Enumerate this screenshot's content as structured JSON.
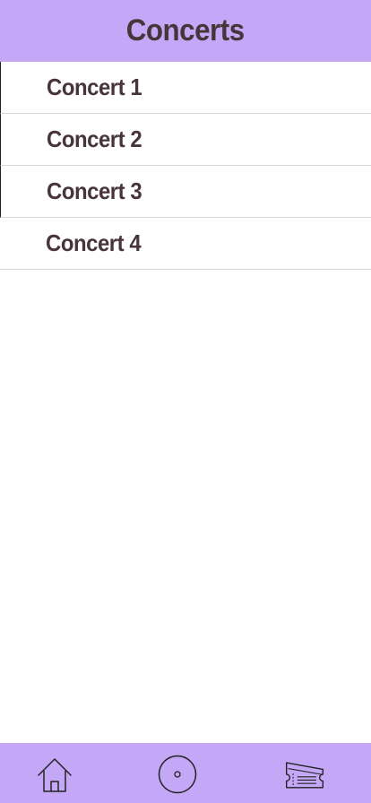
{
  "header": {
    "title": "Concerts"
  },
  "concerts": {
    "items": [
      {
        "label": "Concert 1"
      },
      {
        "label": "Concert 2"
      },
      {
        "label": "Concert 3"
      },
      {
        "label": "Concert 4"
      }
    ]
  },
  "tabbar": {
    "items": [
      {
        "icon": "home-icon"
      },
      {
        "icon": "disc-icon"
      },
      {
        "icon": "ticket-icon"
      }
    ]
  },
  "colors": {
    "accent": "#c4a8f7",
    "text": "#473539",
    "divider": "#d8d8d8"
  }
}
